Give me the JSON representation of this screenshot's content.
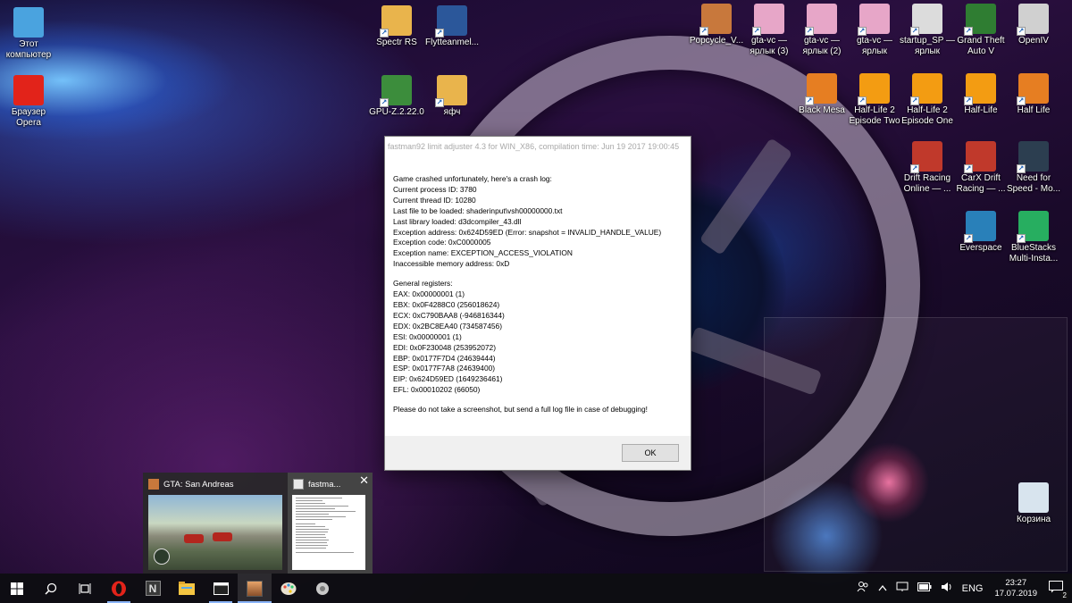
{
  "desktop": {
    "icons": [
      {
        "label": "Этот компьютер",
        "icon": "computer-icon",
        "color": "#4aa3df"
      },
      {
        "label": "Браузер Opera",
        "icon": "opera-icon",
        "color": "#e2231a"
      },
      {
        "label": "Spectr RS",
        "icon": "folder-icon",
        "color": "#e9b44c"
      },
      {
        "label": "Flytteanmel...",
        "icon": "word-document-icon",
        "color": "#2b579a"
      },
      {
        "label": "GPU-Z.2.22.0",
        "icon": "gpuz-icon",
        "color": "#3c8d3c"
      },
      {
        "label": "яфч",
        "icon": "folder-icon",
        "color": "#e9b44c"
      },
      {
        "label": "Popcycle_V...",
        "icon": "popcycle-icon",
        "color": "#c8783c"
      },
      {
        "label": "gta-vc — ярлык (3)",
        "icon": "gta-vc-icon",
        "color": "#e7a6c8"
      },
      {
        "label": "gta-vc — ярлык (2)",
        "icon": "gta-vc-icon",
        "color": "#e7a6c8"
      },
      {
        "label": "gta-vc — ярлык",
        "icon": "gta-vc-icon",
        "color": "#e7a6c8"
      },
      {
        "label": "startup_SP — ярлык",
        "icon": "gears-icon",
        "color": "#dcdcdc"
      },
      {
        "label": "Grand Theft Auto V",
        "icon": "gta-v-icon",
        "color": "#2f7d32"
      },
      {
        "label": "OpenIV",
        "icon": "openiv-icon",
        "color": "#d0d0d0"
      },
      {
        "label": "Black Mesa",
        "icon": "black-mesa-icon",
        "color": "#e67e22"
      },
      {
        "label": "Half-Life 2 Episode Two",
        "icon": "half-life-2-icon",
        "color": "#f39c12"
      },
      {
        "label": "Half-Life 2 Episode One",
        "icon": "half-life-2-icon",
        "color": "#f39c12"
      },
      {
        "label": "Half-Life",
        "icon": "half-life-2-icon",
        "color": "#f39c12"
      },
      {
        "label": "Half Life",
        "icon": "half-life-icon",
        "color": "#e67e22"
      },
      {
        "label": "Drift Racing Online — ...",
        "icon": "drift-racing-icon",
        "color": "#c0392b"
      },
      {
        "label": "CarX Drift Racing — ...",
        "icon": "carx-drift-icon",
        "color": "#c0392b"
      },
      {
        "label": "Need for Speed - Mo...",
        "icon": "nfs-mw-icon",
        "color": "#2c3e50"
      },
      {
        "label": "Everspace",
        "icon": "everspace-icon",
        "color": "#2980b9"
      },
      {
        "label": "BlueStacks Multi-Insta...",
        "icon": "bluestacks-icon",
        "color": "#27ae60"
      },
      {
        "label": "Корзина",
        "icon": "recycle-bin-icon",
        "color": "#d8e4ee"
      }
    ]
  },
  "dialog": {
    "title": "fastman92 limit adjuster 4.3 for WIN_X86, compilation time: Jun 19 2017 19:00:45",
    "crash_lines": [
      "Game crashed unfortunately, here's a crash log:",
      "Current process ID: 3780",
      "Current thread ID: 10280",
      "Last file to be loaded: shaderinput\\vsh00000000.txt",
      "Last library loaded: d3dcompiler_43.dll",
      "Exception address: 0x624D59ED (Error: snapshot = INVALID_HANDLE_VALUE)",
      "Exception code: 0xC0000005",
      "Exception name: EXCEPTION_ACCESS_VIOLATION",
      "Inaccessible memory address: 0xD"
    ],
    "registers_header": "General registers:",
    "registers": [
      "EAX: 0x00000001 (1)",
      "EBX: 0x0F4288C0 (256018624)",
      "ECX: 0xC790BAA8 (-946816344)",
      "EDX: 0x2BC8EA40 (734587456)",
      "ESI: 0x00000001 (1)",
      "EDI: 0x0F230048 (253952072)",
      "EBP: 0x0177F7D4 (24639444)",
      "ESP: 0x0177F7A8 (24639400)",
      "EIP: 0x624D59ED (1649236461)",
      "EFL: 0x00010202 (66050)"
    ],
    "footer_note": "Please do not take a screenshot, but send a full log file in case of debugging!",
    "ok_label": "OK"
  },
  "thumbnails": {
    "gta_title": "GTA: San Andreas",
    "fastman_title": "fastma...",
    "close_glyph": "✕"
  },
  "taskbar": {
    "apps": [
      {
        "name": "start",
        "icon": "windows-logo-icon"
      },
      {
        "name": "search",
        "icon": "search-icon"
      },
      {
        "name": "task-view",
        "icon": "task-view-icon"
      },
      {
        "name": "opera",
        "icon": "opera-icon"
      },
      {
        "name": "notion",
        "icon": "n-app-icon"
      },
      {
        "name": "explorer",
        "icon": "file-explorer-icon"
      },
      {
        "name": "console",
        "icon": "window-app-icon"
      },
      {
        "name": "gta",
        "icon": "gta-sa-icon"
      },
      {
        "name": "paint",
        "icon": "palette-icon"
      },
      {
        "name": "tool",
        "icon": "gears-icon"
      }
    ],
    "tray": {
      "language": "ENG",
      "time": "23:27",
      "date": "17.07.2019",
      "notifications": "2"
    }
  }
}
